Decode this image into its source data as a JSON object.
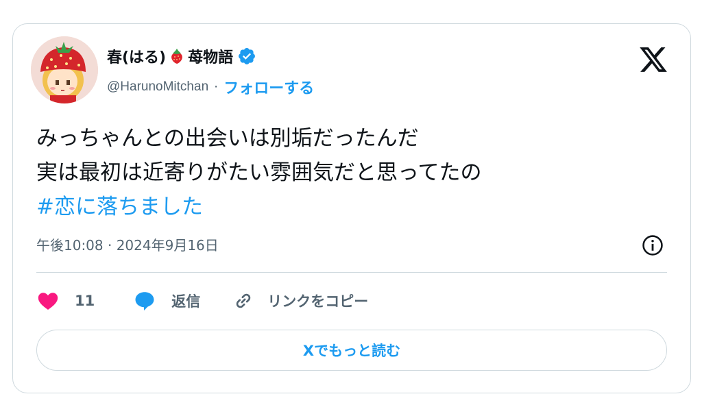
{
  "user": {
    "name": "春(はる)",
    "name_suffix": "苺物語",
    "handle": "@HarunoMitchan",
    "separator": "·",
    "follow_label": "フォローする",
    "verified": true,
    "verified_color": "#1d9bf0"
  },
  "tweet": {
    "lines": [
      "みっちゃんとの出会いは別垢だったんだ",
      "実は最初は近寄りがたい雰囲気だと思ってたの"
    ],
    "hashtag": "#恋に落ちました",
    "timestamp": "午後10:08 · 2024年9月16日"
  },
  "actions": {
    "like_count": "11",
    "reply_label": "返信",
    "copy_link_label": "リンクをコピー"
  },
  "read_more_label": "Xでもっと読む",
  "colors": {
    "accent": "#1d9bf0",
    "like": "#f91880",
    "muted": "#536471",
    "border": "#cfd9de"
  }
}
